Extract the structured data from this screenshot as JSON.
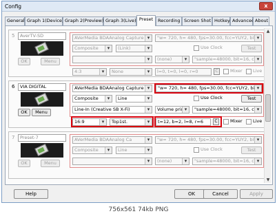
{
  "window": {
    "title": "Config",
    "close": "x"
  },
  "tabs": [
    {
      "label": "General"
    },
    {
      "label": "Graph 1(Device)"
    },
    {
      "label": "Graph 2(Preview)"
    },
    {
      "label": "Graph 3(Live)"
    },
    {
      "label": "Preset"
    },
    {
      "label": "Recording"
    },
    {
      "label": "Screen Shot"
    },
    {
      "label": "Hotkey"
    },
    {
      "label": "Advanced"
    },
    {
      "label": "About"
    }
  ],
  "active_tab": "Preset",
  "presets": [
    {
      "number": "5",
      "name": "AverTV-SD",
      "device": "AVerMedia BDAAnalog Capture",
      "input": "Composite",
      "crossbar": "(Link)",
      "audio_device": "",
      "audio_input": "(none)",
      "aspect": "4:3",
      "deinterlace": "None",
      "video_format": "\"w= 720, h= 480, fps=30.00, fcc=YUY2, bit=16\"",
      "audio_format": "\"sample=48000, bit=16, ch=2\"",
      "crop": "l=0, t=0, l=0, r=0",
      "use_clock": "Use Clock",
      "test": "Test",
      "mixer": "Mixer",
      "live": "Live",
      "ok": "OK",
      "menu": "Menu",
      "c": "C",
      "enabled": false
    },
    {
      "number": "6",
      "name": "VIA DIGITAL",
      "device": "AVerMedia BDAAnalog Capture",
      "input": "Composite",
      "crossbar": "Line",
      "audio_device": "Line-In (Creative SB X-Fi)",
      "audio_input": "Volume princ",
      "aspect": "16:9",
      "deinterlace": "Top1st.",
      "video_format": "\"w= 720, h= 480, fps=30.00, fcc=YUY2, bit=16\"",
      "audio_format": "\"sample=48000, bit=16, ch=2\"",
      "crop": "t=12, b=2, l=8, r=6",
      "use_clock": "Use Clock",
      "test": "Test",
      "mixer": "Mixer",
      "live": "Live",
      "ok": "OK",
      "menu": "Menu",
      "c": "C",
      "enabled": true
    },
    {
      "number": "7",
      "name": "Preset-7",
      "device": "AVerMedia BDAAnalog Ca",
      "input": "Composite",
      "crossbar": "Line",
      "audio_device": "",
      "audio_input": "(none)",
      "aspect": "",
      "deinterlace": "",
      "video_format": "\"w= 720, h= 480, fps=30.00, fcc=YUY2, bit=16\"",
      "audio_format": "\"sample=48000, bit=16, ch=2\"",
      "crop": "",
      "use_clock": "Use Clock",
      "test": "Test",
      "mixer": "",
      "live": "",
      "ok": "OK",
      "menu": "Menu",
      "c": "",
      "enabled": false
    }
  ],
  "buttons": {
    "help": "Help",
    "ok": "OK",
    "cancel": "Cancel",
    "apply": "Apply"
  },
  "status": "756x561 74kb PNG",
  "colors": {
    "highlight": "#d8000c",
    "group_border": "#e08a8a"
  }
}
